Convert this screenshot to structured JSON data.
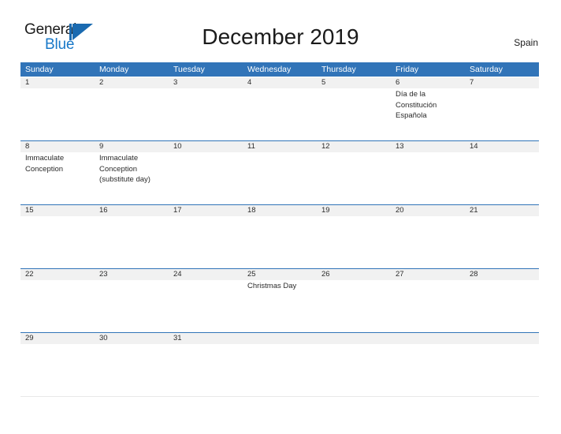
{
  "brand": {
    "word_one": "General",
    "word_two": "Blue",
    "mark_icon": "flag-triangle-icon",
    "accent_color": "#1a6ab0",
    "blue_text_color": "#1878c8"
  },
  "header": {
    "title": "December 2019",
    "country": "Spain"
  },
  "calendar": {
    "header_bg": "#3174b8",
    "band_bg": "#f1f1f1",
    "day_names": [
      "Sunday",
      "Monday",
      "Tuesday",
      "Wednesday",
      "Thursday",
      "Friday",
      "Saturday"
    ],
    "weeks": [
      {
        "days": [
          {
            "num": "1",
            "event": ""
          },
          {
            "num": "2",
            "event": ""
          },
          {
            "num": "3",
            "event": ""
          },
          {
            "num": "4",
            "event": ""
          },
          {
            "num": "5",
            "event": ""
          },
          {
            "num": "6",
            "event": "Día de la Constitución Española"
          },
          {
            "num": "7",
            "event": ""
          }
        ]
      },
      {
        "days": [
          {
            "num": "8",
            "event": "Immaculate Conception"
          },
          {
            "num": "9",
            "event": "Immaculate Conception (substitute day)"
          },
          {
            "num": "10",
            "event": ""
          },
          {
            "num": "11",
            "event": ""
          },
          {
            "num": "12",
            "event": ""
          },
          {
            "num": "13",
            "event": ""
          },
          {
            "num": "14",
            "event": ""
          }
        ]
      },
      {
        "days": [
          {
            "num": "15",
            "event": ""
          },
          {
            "num": "16",
            "event": ""
          },
          {
            "num": "17",
            "event": ""
          },
          {
            "num": "18",
            "event": ""
          },
          {
            "num": "19",
            "event": ""
          },
          {
            "num": "20",
            "event": ""
          },
          {
            "num": "21",
            "event": ""
          }
        ]
      },
      {
        "days": [
          {
            "num": "22",
            "event": ""
          },
          {
            "num": "23",
            "event": ""
          },
          {
            "num": "24",
            "event": ""
          },
          {
            "num": "25",
            "event": "Christmas Day"
          },
          {
            "num": "26",
            "event": ""
          },
          {
            "num": "27",
            "event": ""
          },
          {
            "num": "28",
            "event": ""
          }
        ]
      },
      {
        "days": [
          {
            "num": "29",
            "event": ""
          },
          {
            "num": "30",
            "event": ""
          },
          {
            "num": "31",
            "event": ""
          },
          {
            "num": "",
            "event": ""
          },
          {
            "num": "",
            "event": ""
          },
          {
            "num": "",
            "event": ""
          },
          {
            "num": "",
            "event": ""
          }
        ]
      }
    ]
  }
}
